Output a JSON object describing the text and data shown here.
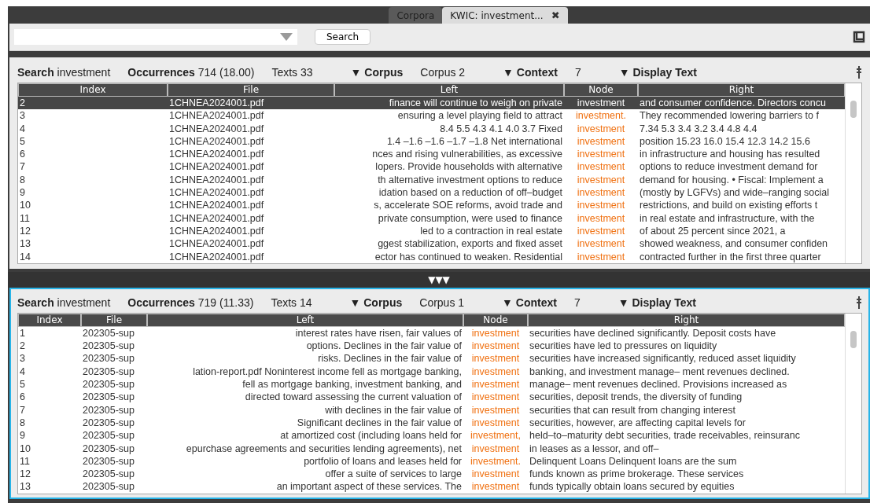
{
  "tabs": [
    {
      "label": "Corpora",
      "selected": false
    },
    {
      "label": "KWIC:  investment...",
      "selected": true,
      "close": "✖"
    }
  ],
  "search_bar": {
    "button": "Search"
  },
  "panes": [
    {
      "active": false,
      "search_label": "Search",
      "search": "investment",
      "occurrences_label": "Occurrences",
      "occurrences": "714 (18.00)",
      "texts_label": "Texts",
      "texts": "33",
      "corpus_menu": "▼ Corpus",
      "corpus": "Corpus 2",
      "context_menu": "▼ Context",
      "context": "7",
      "display_menu": "▼ Display Text",
      "columns": [
        "Index",
        "File",
        "Left",
        "Node",
        "Right"
      ],
      "rows": [
        {
          "index": "2",
          "file": "1CHNEA2024001.pdf",
          "left": "finance will continue to weigh on private",
          "node": "investment",
          "right": "and consumer confidence. Directors concu",
          "selected": true
        },
        {
          "index": "3",
          "file": "1CHNEA2024001.pdf",
          "left": "ensuring a level playing field to attract",
          "node": "investment.",
          "right": "They recommended lowering barriers to f",
          "selected": false
        },
        {
          "index": "4",
          "file": "1CHNEA2024001.pdf",
          "left": "8.4 5.5 4.3 4.1 4.0 3.7 Fixed",
          "node": "investment",
          "right": "7.34 5.3 3.4 3.2 3.4 4.8 4.4",
          "selected": false
        },
        {
          "index": "5",
          "file": "1CHNEA2024001.pdf",
          "left": "1.4 –1.6 –1.6 –1.7 –1.8 Net international",
          "node": "investment",
          "right": "position 15.23 16.0 15.4 12.3 14.2 15.6",
          "selected": false
        },
        {
          "index": "6",
          "file": "1CHNEA2024001.pdf",
          "left": "nces and rising vulnerabilities, as excessive",
          "node": "investment",
          "right": "in infrastructure and housing has resulted",
          "selected": false
        },
        {
          "index": "7",
          "file": "1CHNEA2024001.pdf",
          "left": "lopers. Provide households with alternative",
          "node": "investment",
          "right": "options to reduce investment demand for",
          "selected": false
        },
        {
          "index": "8",
          "file": "1CHNEA2024001.pdf",
          "left": "th alternative investment options to reduce",
          "node": "investment",
          "right": "demand for housing. • Fiscal: Implement a",
          "selected": false
        },
        {
          "index": "9",
          "file": "1CHNEA2024001.pdf",
          "left": "idation based on a reduction of off–budget",
          "node": "investment",
          "right": "(mostly by LGFVs) and wide–ranging social",
          "selected": false
        },
        {
          "index": "10",
          "file": "1CHNEA2024001.pdf",
          "left": "s, accelerate SOE reforms, avoid trade and",
          "node": "investment",
          "right": "restrictions, and build on existing efforts t",
          "selected": false
        },
        {
          "index": "11",
          "file": "1CHNEA2024001.pdf",
          "left": "private consumption, were used to finance",
          "node": "investment",
          "right": "in real estate and infrastructure, with the",
          "selected": false
        },
        {
          "index": "12",
          "file": "1CHNEA2024001.pdf",
          "left": "led to a contraction in real estate",
          "node": "investment",
          "right": "of about 25 percent since 2021, a",
          "selected": false
        },
        {
          "index": "13",
          "file": "1CHNEA2024001.pdf",
          "left": "ggest stabilization, exports and fixed asset",
          "node": "investment",
          "right": "showed weakness, and consumer confiden",
          "selected": false
        },
        {
          "index": "14",
          "file": "1CHNEA2024001.pdf",
          "left": "ector has continued to weaken. Residential",
          "node": "investment",
          "right": "contracted further in the first three quarter",
          "selected": false
        }
      ]
    },
    {
      "active": true,
      "search_label": "Search",
      "search": "investment",
      "occurrences_label": "Occurrences",
      "occurrences": "719 (11.33)",
      "texts_label": "Texts",
      "texts": "14",
      "corpus_menu": "▼ Corpus",
      "corpus": "Corpus 1",
      "context_menu": "▼ Context",
      "context": "7",
      "display_menu": "▼ Display Text",
      "columns": [
        "Index",
        "File",
        "Left",
        "Node",
        "Right"
      ],
      "rows": [
        {
          "index": "1",
          "file": "202305-sup",
          "left": "interest rates have risen, fair values of",
          "node": "investment",
          "right": "securities have declined significantly. Deposit costs have",
          "selected": false
        },
        {
          "index": "2",
          "file": "202305-sup",
          "left": "options. Declines in the fair value of",
          "node": "investment",
          "right": "securities have led to pressures on liquidity",
          "selected": false
        },
        {
          "index": "3",
          "file": "202305-sup",
          "left": "risks. Declines in the fair value of",
          "node": "investment",
          "right": "securities have increased significantly, reduced asset liquidity",
          "selected": false
        },
        {
          "index": "4",
          "file": "202305-sup",
          "left": "lation-report.pdf Noninterest income fell as mortgage banking,",
          "node": "investment",
          "right": "banking, and investment manage– ment revenues declined.",
          "selected": false
        },
        {
          "index": "5",
          "file": "202305-sup",
          "left": "fell as mortgage banking, investment banking, and",
          "node": "investment",
          "right": "manage– ment revenues declined. Provisions increased as",
          "selected": false
        },
        {
          "index": "6",
          "file": "202305-sup",
          "left": "directed toward assessing the current valuation of",
          "node": "investment",
          "right": "securities, deposit trends, the diversity of funding",
          "selected": false
        },
        {
          "index": "7",
          "file": "202305-sup",
          "left": "with declines in the fair value of",
          "node": "investment",
          "right": "securities that can result from changing interest",
          "selected": false
        },
        {
          "index": "8",
          "file": "202305-sup",
          "left": "Significant declines in the fair value of",
          "node": "investment",
          "right": "securities, however, are affecting capital levels for",
          "selected": false
        },
        {
          "index": "9",
          "file": "202305-sup",
          "left": "at amortized cost (including loans held for",
          "node": "investment,",
          "right": "held–to–maturity debt securities, trade receivables, reinsuranc",
          "selected": false
        },
        {
          "index": "10",
          "file": "202305-sup",
          "left": "epurchase agreements and securities lending agreements), net",
          "node": "investment",
          "right": "in leases as a lessor, and off–",
          "selected": false
        },
        {
          "index": "11",
          "file": "202305-sup",
          "left": "portfolio of loans and leases held for",
          "node": "investment.",
          "right": "Delinquent Loans Delinquent loans are the sum",
          "selected": false
        },
        {
          "index": "12",
          "file": "202305-sup",
          "left": "offer a suite of services to large",
          "node": "investment",
          "right": "funds known as prime brokerage. These services",
          "selected": false
        },
        {
          "index": "13",
          "file": "202305-sup",
          "left": "an important aspect of these services. The",
          "node": "investment",
          "right": "funds typically obtain loans secured by equities",
          "selected": false
        }
      ]
    }
  ],
  "divider": "▼▼▼"
}
